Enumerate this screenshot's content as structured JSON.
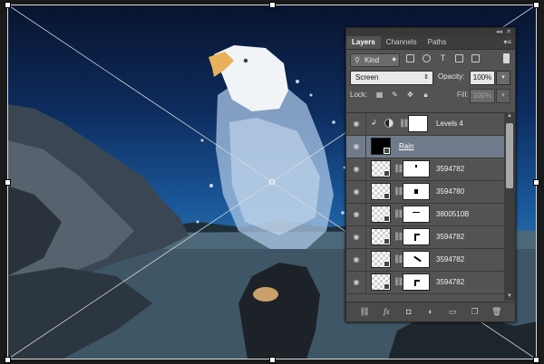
{
  "panel": {
    "tabs": [
      {
        "label": "Layers",
        "active": true
      },
      {
        "label": "Channels",
        "active": false
      },
      {
        "label": "Paths",
        "active": false
      }
    ],
    "filter": {
      "icon": "search-icon",
      "label": "Kind"
    },
    "blend_mode": "Screen",
    "opacity_label": "Opacity:",
    "opacity_value": "100%",
    "lock_label": "Lock:",
    "fill_label": "Fill:",
    "fill_value": "100%",
    "layers": [
      {
        "name": "Levels 4",
        "type": "adjustment",
        "visible": true,
        "selected": false
      },
      {
        "name": "Rain",
        "type": "editing",
        "visible": true,
        "selected": true
      },
      {
        "name": "3594782",
        "type": "smart-object",
        "visible": true,
        "selected": false
      },
      {
        "name": "3594780",
        "type": "smart-object",
        "visible": true,
        "selected": false
      },
      {
        "name": "3800510B",
        "type": "smart-object",
        "visible": true,
        "selected": false
      },
      {
        "name": "3594782",
        "type": "smart-object",
        "visible": true,
        "selected": false
      },
      {
        "name": "3594782",
        "type": "smart-object",
        "visible": true,
        "selected": false
      },
      {
        "name": "3594782",
        "type": "smart-object",
        "visible": true,
        "selected": false
      }
    ],
    "bottom_icons": [
      "link-icon",
      "fx-icon",
      "mask-icon",
      "adjustment-icon",
      "folder-icon",
      "new-layer-icon",
      "trash-icon"
    ]
  },
  "colors": {
    "panel_bg": "#535353",
    "selected_layer": "#6f7b8a",
    "sky_top": "#08142e",
    "sky_mid": "#1b5a9c"
  }
}
